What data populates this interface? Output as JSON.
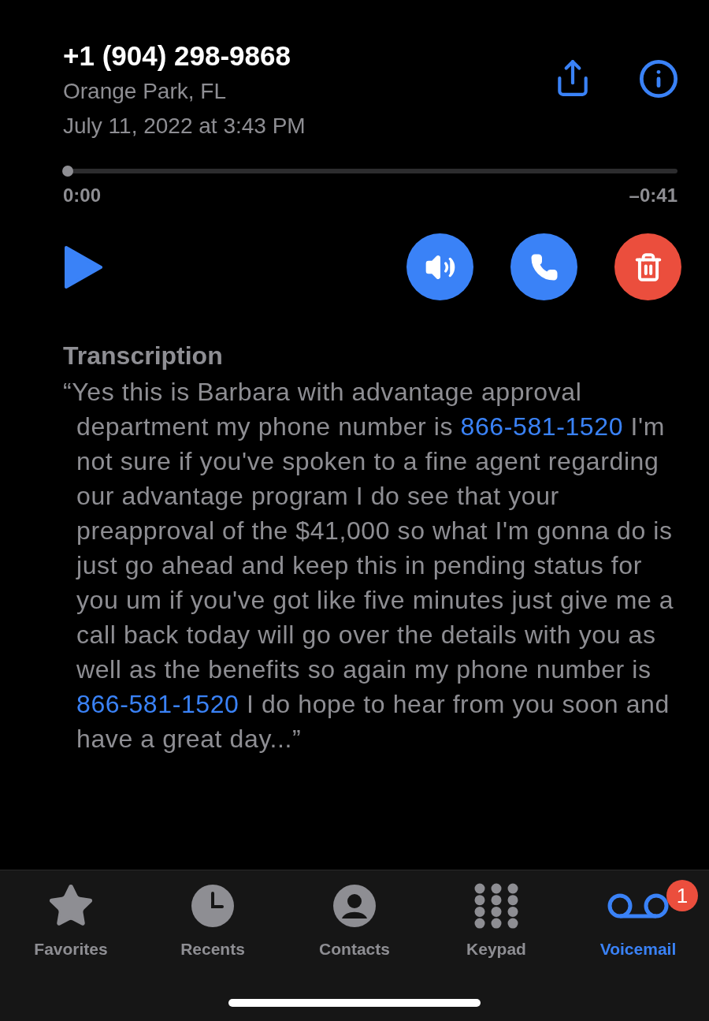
{
  "caller": {
    "number": "+1 (904) 298-9868",
    "location": "Orange Park, FL",
    "date": "July 11, 2022 at 3:43 PM"
  },
  "playback": {
    "level": 0,
    "elapsed": "0:00",
    "remaining": "–0:41"
  },
  "actions": [
    {
      "kind": "speaker",
      "on": false
    },
    {
      "kind": "call"
    },
    {
      "kind": "delete"
    }
  ],
  "transcription": {
    "heading": "Transcription",
    "segments": [
      {
        "kind": "text",
        "text": "“Yes this is Barbara with advantage approval department my phone number is "
      },
      {
        "kind": "link",
        "text": "866-581-1520"
      },
      {
        "kind": "text",
        "text": " I'm not sure if you've spoken to a fine agent regarding our advantage program I do see that your preapproval of the $41,000 so what I'm gonna do is just go ahead and keep this in pending status for you um if you've got like five minutes just give me a call back today will go over the details with you as well as the benefits so again my phone number is "
      },
      {
        "kind": "link",
        "text": "866-581-1520"
      },
      {
        "kind": "text",
        "text": " I do hope to hear from you soon and have a great day...”"
      }
    ]
  },
  "tabs": [
    {
      "kind": "favorites",
      "label": "Favorites",
      "selected": false
    },
    {
      "kind": "recents",
      "label": "Recents",
      "selected": false
    },
    {
      "kind": "contacts",
      "label": "Contacts",
      "selected": false
    },
    {
      "kind": "keypad",
      "label": "Keypad",
      "selected": false
    },
    {
      "kind": "voicemail",
      "label": "Voicemail",
      "selected": true,
      "badge": "1"
    }
  ]
}
